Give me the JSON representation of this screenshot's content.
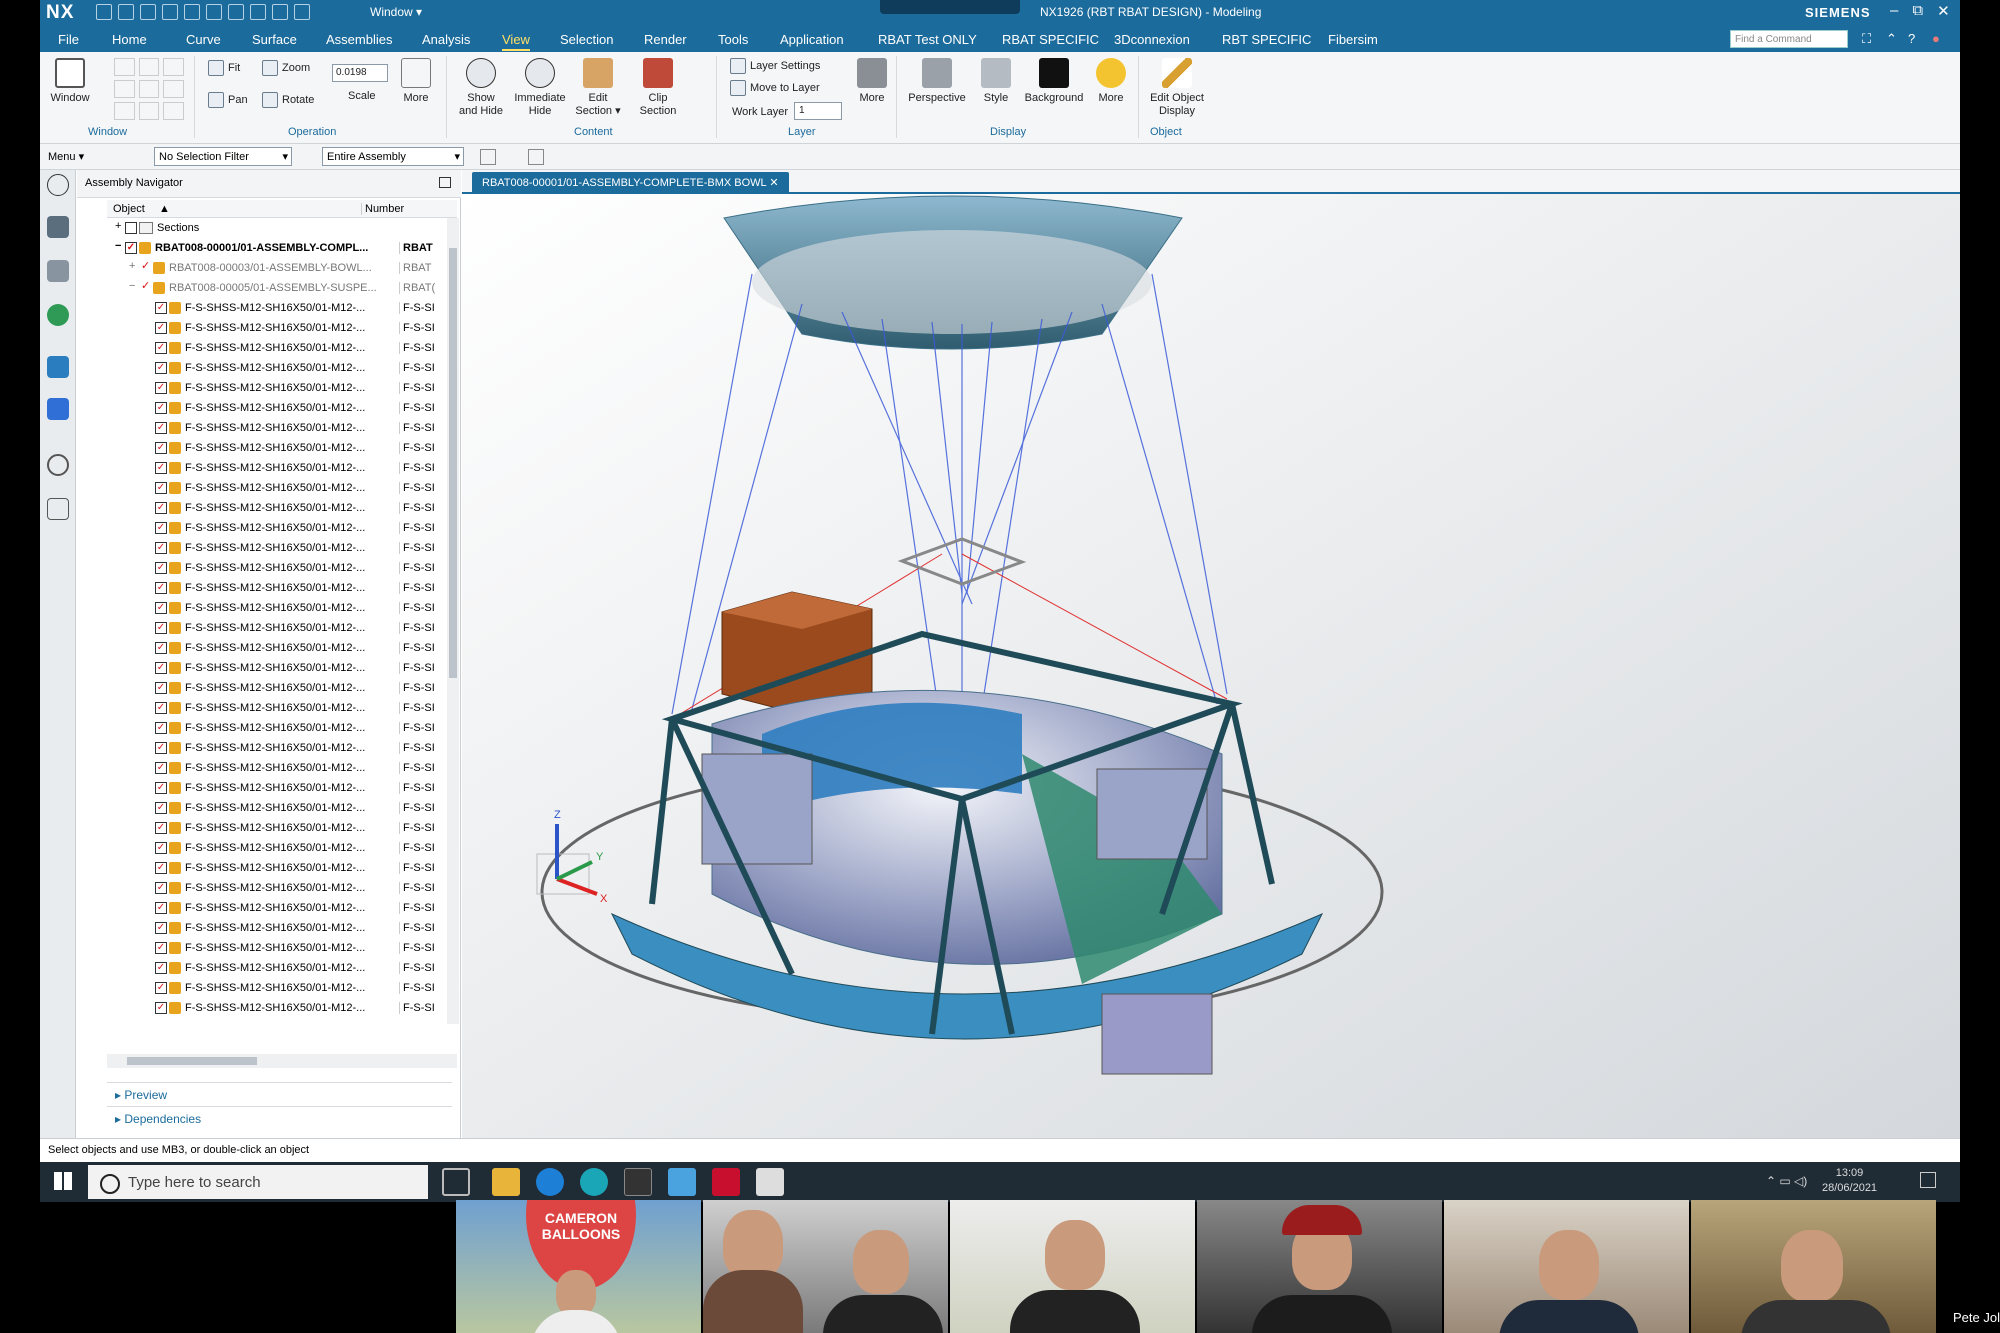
{
  "titlebar": {
    "app": "NX",
    "window_menu": "Window ▾",
    "title": "NX1926 (RBT RBAT DESIGN) - Modeling",
    "brand": "SIEMENS",
    "controls": [
      "–",
      "⧉",
      "✕"
    ]
  },
  "menubar": {
    "tabs": [
      "File",
      "Home",
      "Curve",
      "Surface",
      "Assemblies",
      "Analysis",
      "View",
      "Selection",
      "Render",
      "Tools",
      "Application",
      "RBAT Test ONLY",
      "RBAT SPECIFIC",
      "3Dconnexion",
      "RBT SPECIFIC",
      "Fibersim"
    ],
    "active": "View",
    "find_placeholder": "Find a Command"
  },
  "ribbon": {
    "window": {
      "btn": "Window",
      "group": "Window"
    },
    "operation": {
      "fit": "Fit",
      "zoom": "Zoom",
      "pan": "Pan",
      "rotate": "Rotate",
      "scale_value": "0.0198",
      "scale": "Scale",
      "more": "More",
      "group": "Operation"
    },
    "content": {
      "show_hide": "Show\nand Hide",
      "immediate_hide": "Immediate\nHide",
      "edit_section": "Edit\nSection ▾",
      "clip_section": "Clip\nSection",
      "group": "Content"
    },
    "layer": {
      "settings": "Layer Settings",
      "move": "Move to Layer",
      "work_layer": "Work Layer",
      "work_value": "1",
      "more": "More",
      "group": "Layer"
    },
    "display": {
      "perspective": "Perspective",
      "style": "Style",
      "background": "Background",
      "more": "More",
      "group": "Display"
    },
    "object": {
      "edit_display": "Edit Object\nDisplay",
      "group": "Object"
    }
  },
  "selbar": {
    "menu": "Menu ▾",
    "filter": "No Selection Filter",
    "scope": "Entire Assembly"
  },
  "navigator": {
    "title": "Assembly Navigator",
    "col_object": "Object",
    "col_number": "Number",
    "sections": "Sections",
    "root": {
      "name": "RBAT008-00001/01-ASSEMBLY-COMPL...",
      "num": "RBAT"
    },
    "child1": {
      "name": "RBAT008-00003/01-ASSEMBLY-BOWL...",
      "num": "RBAT"
    },
    "child2": {
      "name": "RBAT008-00005/01-ASSEMBLY-SUSPE...",
      "num": "RBAT("
    },
    "part_name": "F-S-SHSS-M12-SH16X50/01-M12-...",
    "part_num": "F-S-SI",
    "part_count": 38,
    "preview": "Preview",
    "dependencies": "Dependencies"
  },
  "graphics": {
    "tab": "RBAT008-00001/01-ASSEMBLY-COMPLETE-BMX BOWL",
    "axis": {
      "x": "X",
      "y": "Y",
      "z": "Z"
    }
  },
  "status": "Select objects and use MB3, or double-click an object",
  "taskbar": {
    "search": "Type here to search",
    "time": "13:09",
    "date": "28/06/2021"
  },
  "video": {
    "balloon_text": "CAMERON\nBALLOONS",
    "name_label": "Pete Jol"
  },
  "colors": {
    "accent": "#1b6b9c",
    "active_tab": "#ffe066",
    "bowl": "#3aa3d6",
    "frame": "#1f4a58",
    "cable": "#3b5bd9",
    "box": "#8b3b12"
  }
}
